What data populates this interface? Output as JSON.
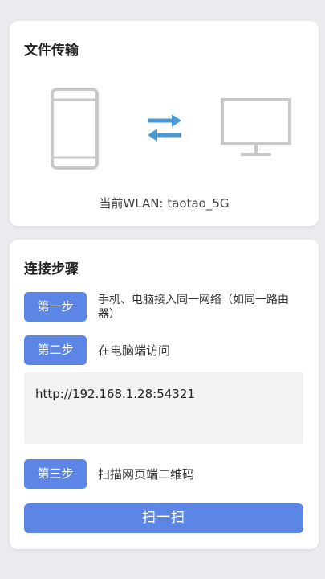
{
  "transfer_card": {
    "title": "文件传输",
    "wlan_text": "当前WLAN: taotao_5G",
    "icons": [
      "phone-icon",
      "transfer-arrows-icon",
      "monitor-icon"
    ],
    "colors": {
      "icon_gray": "#c8c8c8",
      "arrow_blue": "#4a9ad6"
    }
  },
  "steps_card": {
    "title": "连接步骤",
    "steps": [
      {
        "label": "第一步",
        "text": "手机、电脑接入同一网络（如同一路由器）"
      },
      {
        "label": "第二步",
        "text": "在电脑端访问"
      },
      {
        "label": "第三步",
        "text": "扫描网页端二维码"
      }
    ],
    "url": "http://192.168.1.28:54321",
    "scan_button": "扫一扫",
    "colors": {
      "accent": "#5b86e5"
    }
  }
}
